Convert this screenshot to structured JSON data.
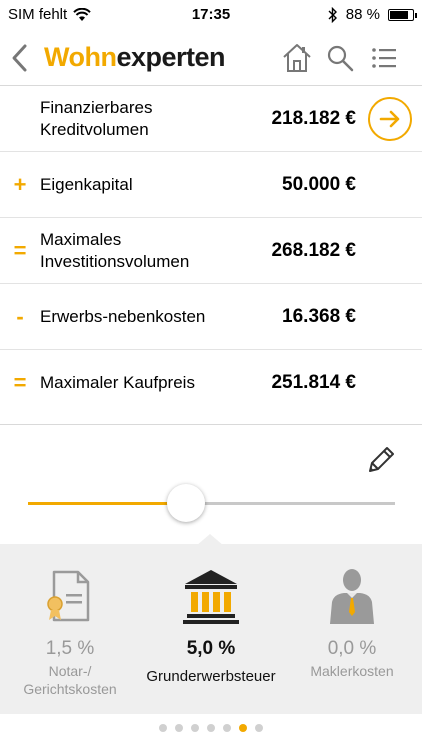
{
  "status": {
    "carrier": "SIM fehlt",
    "time": "17:35",
    "battery": "88 %",
    "battery_level": 0.88
  },
  "header": {
    "logo_part1": "Wohn",
    "logo_part2": "experten",
    "back_icon": "chevron-left-icon",
    "icons": [
      "home-icon",
      "search-icon",
      "menu-icon"
    ]
  },
  "calc": {
    "rows": [
      {
        "op": "",
        "label": "Finanzierbares Kreditvolumen",
        "value": "218.182 €"
      },
      {
        "op": "+",
        "label": "Eigenkapital",
        "value": "50.000 €"
      },
      {
        "op": "=",
        "label": "Maximales Investitionsvolumen",
        "value": "268.182 €"
      },
      {
        "op": "-",
        "label": "Erwerbs-nebenkosten",
        "value": "16.368 €"
      },
      {
        "op": "=",
        "label": "Maximaler Kaufpreis",
        "value": "251.814 €"
      }
    ]
  },
  "slider": {
    "value_fraction": 0.43
  },
  "costs": [
    {
      "value": "1,5 %",
      "label": "Notar-/ Gerichtskosten",
      "icon": "document-seal-icon",
      "active": false
    },
    {
      "value": "5,0 %",
      "label": "Grunderwerbsteuer",
      "icon": "bank-building-icon",
      "active": true
    },
    {
      "value": "0,0 %",
      "label": "Maklerkosten",
      "icon": "businessman-icon",
      "active": false
    }
  ],
  "pager": {
    "count": 7,
    "active_index": 5
  },
  "colors": {
    "accent": "#f2a900",
    "inactive": "#999999"
  }
}
